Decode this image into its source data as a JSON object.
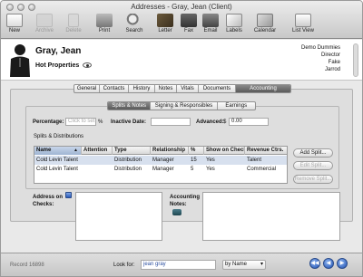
{
  "window": {
    "title": "Addresses - Gray, Jean (Client)"
  },
  "toolbar": [
    {
      "label": "New",
      "enabled": true,
      "icon": "new-icon"
    },
    {
      "label": "Archive",
      "enabled": false,
      "icon": "archive-icon"
    },
    {
      "label": "Delete",
      "enabled": false,
      "icon": "delete-icon"
    },
    {
      "label": "Print",
      "enabled": true,
      "icon": "print-icon"
    },
    {
      "label": "Search",
      "enabled": true,
      "icon": "search-icon"
    },
    {
      "label": "Letter",
      "enabled": true,
      "icon": "letter-icon"
    },
    {
      "label": "Fax",
      "enabled": true,
      "icon": "fax-icon"
    },
    {
      "label": "Email",
      "enabled": true,
      "icon": "email-icon"
    },
    {
      "label": "Labels",
      "enabled": true,
      "icon": "labels-icon"
    },
    {
      "label": "Calendar",
      "enabled": true,
      "icon": "calendar-icon"
    },
    {
      "label": "List View",
      "enabled": true,
      "icon": "list-view-icon"
    }
  ],
  "header": {
    "name": "Gray, Jean",
    "hot": "Hot Properties",
    "company_lines": [
      "Demo Dummies",
      "Director",
      "Fake",
      "Jarrod"
    ]
  },
  "tabs": [
    "General",
    "Contacts",
    "History",
    "Notes",
    "Vitals",
    "Documents",
    "Accounting"
  ],
  "active_tab": "Accounting",
  "subtabs": [
    "Splits & Notes",
    "Signing & Responsibles",
    "Earnings"
  ],
  "active_subtab": "Splits & Notes",
  "form": {
    "percentage_label": "Percentage:",
    "percentage_placeholder": "Click to set",
    "percentage_unit": "%",
    "inactive_label": "Inactive Date:",
    "advanced_label": "Advanced:",
    "advanced_currency": "$",
    "advanced_value": "0.00",
    "splits_label": "Splits & Distributions"
  },
  "table": {
    "headers": [
      "Name",
      "Attention",
      "Type",
      "Relationship",
      "%",
      "Show on Check",
      "Revenue Ctrs."
    ],
    "rows": [
      [
        "Cold Levin Talent",
        "",
        "Distribution",
        "Manager",
        "15",
        "Yes",
        "Talent"
      ],
      [
        "Cold Levin Talent",
        "",
        "Distribution",
        "Manager",
        "5",
        "Yes",
        "Commercial"
      ]
    ]
  },
  "buttons": {
    "add_split": "Add Split...",
    "edit_split": "Edit Split...",
    "remove_split": "Remove Split..."
  },
  "address_label": "Address on Checks:",
  "accounting_notes_label": "Accounting Notes:",
  "bottom": {
    "record": "Record 16898",
    "look_for_label": "Look for:",
    "look_for_value": "jean gray",
    "by_option": "by Name"
  }
}
